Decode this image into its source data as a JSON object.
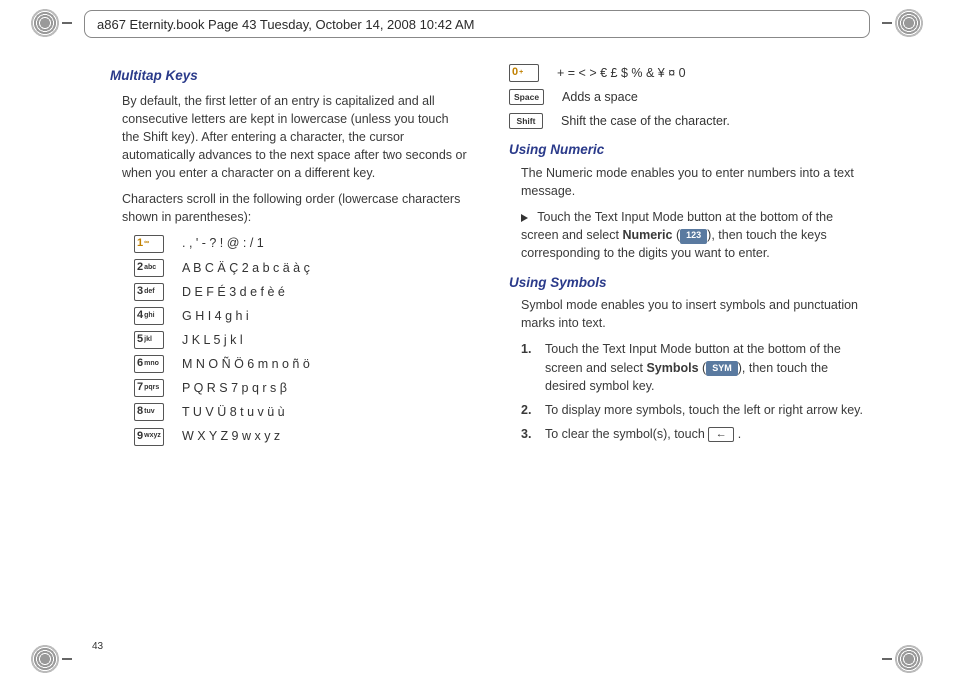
{
  "header_text": "a867 Eternity.book  Page 43  Tuesday, October 14, 2008  10:42 AM",
  "page_number": "43",
  "left": {
    "heading": "Multitap Keys",
    "para1": "By default, the first letter of an entry is capitalized and all consecutive letters are kept in lowercase (unless you touch the Shift key). After entering a character, the cursor automatically advances to the next space after two seconds or when you enter a character on a different key.",
    "para2": "Characters scroll in the following order (lowercase characters shown in parentheses):",
    "keys": [
      {
        "cap_big": "1",
        "cap_sub": "∞",
        "hl": true,
        "chars": ". , ' - ? ! @ : / 1"
      },
      {
        "cap_big": "2",
        "cap_sub": "abc",
        "hl": false,
        "chars": "A B C Ä Ç 2 a b c ä à ç"
      },
      {
        "cap_big": "3",
        "cap_sub": "def",
        "hl": false,
        "chars": "D E F É 3 d e f è é"
      },
      {
        "cap_big": "4",
        "cap_sub": "ghi",
        "hl": false,
        "chars": "G H I 4 g h i"
      },
      {
        "cap_big": "5",
        "cap_sub": "jkl",
        "hl": false,
        "chars": "J K L 5 j k l"
      },
      {
        "cap_big": "6",
        "cap_sub": "mno",
        "hl": false,
        "chars": "M N O Ñ Ö 6 m n o ñ ö"
      },
      {
        "cap_big": "7",
        "cap_sub": "pqrs",
        "hl": false,
        "chars": "P Q R S 7 p q r s β"
      },
      {
        "cap_big": "8",
        "cap_sub": "tuv",
        "hl": false,
        "chars": "T U V Ü 8 t u v ü ù"
      },
      {
        "cap_big": "9",
        "cap_sub": "wxyz",
        "hl": false,
        "chars": "W X Y Z 9 w x y z"
      }
    ]
  },
  "right": {
    "top_keys": [
      {
        "cap_big": "0",
        "cap_sub": "+",
        "hl": true,
        "word": null,
        "chars": "+ = < > € £ $ % & ¥ ¤ 0"
      },
      {
        "cap_big": null,
        "cap_sub": null,
        "hl": false,
        "word": "Space",
        "chars": "Adds a space"
      },
      {
        "cap_big": null,
        "cap_sub": null,
        "hl": false,
        "word": "Shift",
        "chars": "Shift the case of the character."
      }
    ],
    "num_heading": "Using Numeric",
    "num_para": "The Numeric mode enables you to enter numbers into a text message.",
    "num_step_pre": "Touch the Text Input Mode button at the bottom of the screen and select ",
    "num_bold": "Numeric",
    "num_btn": "123",
    "num_step_post": ", then touch the keys corresponding to the digits you want to enter.",
    "sym_heading": "Using Symbols",
    "sym_para": "Symbol mode enables you to insert symbols and punctuation marks into text.",
    "sym_steps": {
      "s1_pre": "Touch the Text Input Mode button at the bottom of the screen and select ",
      "s1_bold": "Symbols",
      "s1_btn": "SYM",
      "s1_post": ", then touch the desired symbol key.",
      "s2": "To display more symbols, touch the left or right arrow key.",
      "s3_pre": "To clear the symbol(s), touch ",
      "s3_post": " ."
    },
    "n1": "1.",
    "n2": "2.",
    "n3": "3.",
    "paren_open": " (",
    "paren_close": ")"
  }
}
